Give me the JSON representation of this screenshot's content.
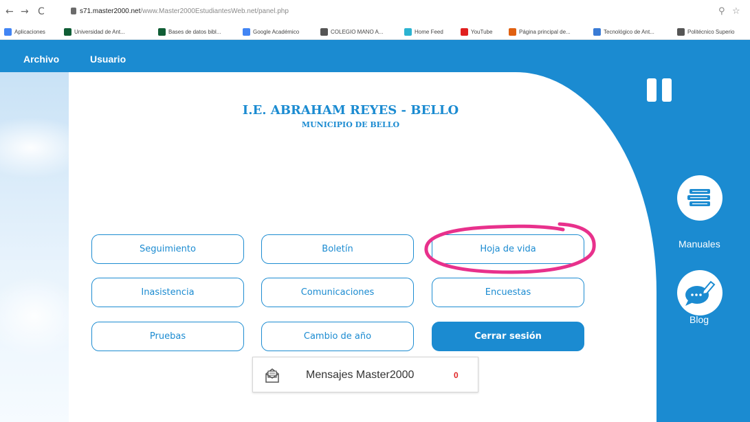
{
  "browser": {
    "nav": {
      "back": "←",
      "forward": "→",
      "reload": "C"
    },
    "url_host": "s71.master2000.net",
    "url_path": "/www.Master2000EstudiantesWeb.net/panel.php",
    "right_icons": {
      "zoom": "⚲",
      "star": "☆"
    },
    "bookmarks": [
      {
        "label": "Aplicaciones",
        "color": "#4285f4"
      },
      {
        "label": "Universidad de Ant...",
        "color": "#0f5d35"
      },
      {
        "label": "Bases de datos bibl...",
        "color": "#0f5d35"
      },
      {
        "label": "Google Académico",
        "color": "#4285f4"
      },
      {
        "label": "COLEGIO MANO A...",
        "color": "#555555"
      },
      {
        "label": "Home Feed",
        "color": "#2bb3d1"
      },
      {
        "label": "YouTube",
        "color": "#e02020"
      },
      {
        "label": "Página principal de...",
        "color": "#e06010"
      },
      {
        "label": "Tecnológico de Ant...",
        "color": "#3a7bd5"
      },
      {
        "label": "Politécnico Superio",
        "color": "#555555"
      }
    ]
  },
  "menu": {
    "archivo": "Archivo",
    "usuario": "Usuario"
  },
  "school": {
    "name": "I.E. ABRAHAM REYES - BELLO",
    "municipality": "MUNICIPIO DE BELLO"
  },
  "buttons": {
    "seguimiento": "Seguimiento",
    "boletin": "Boletín",
    "hoja_de_vida": "Hoja de vida",
    "inasistencia": "Inasistencia",
    "comunicaciones": "Comunicaciones",
    "encuestas": "Encuestas",
    "pruebas": "Pruebas",
    "cambio_de_ano": "Cambio de año",
    "cerrar_sesion": "Cerrar sesión"
  },
  "messages": {
    "label": "Mensajes Master2000",
    "count": "0"
  },
  "side": {
    "manuales": "Manuales",
    "blog": "Blog"
  },
  "colors": {
    "brand_blue": "#1b8bd1",
    "highlight_pink": "#e8318c",
    "count_red": "#e02626"
  },
  "icons": {
    "pause": "pause-icon",
    "manuales": "books-icon",
    "blog": "chat-pen-icon",
    "messages": "envelope-icon"
  }
}
